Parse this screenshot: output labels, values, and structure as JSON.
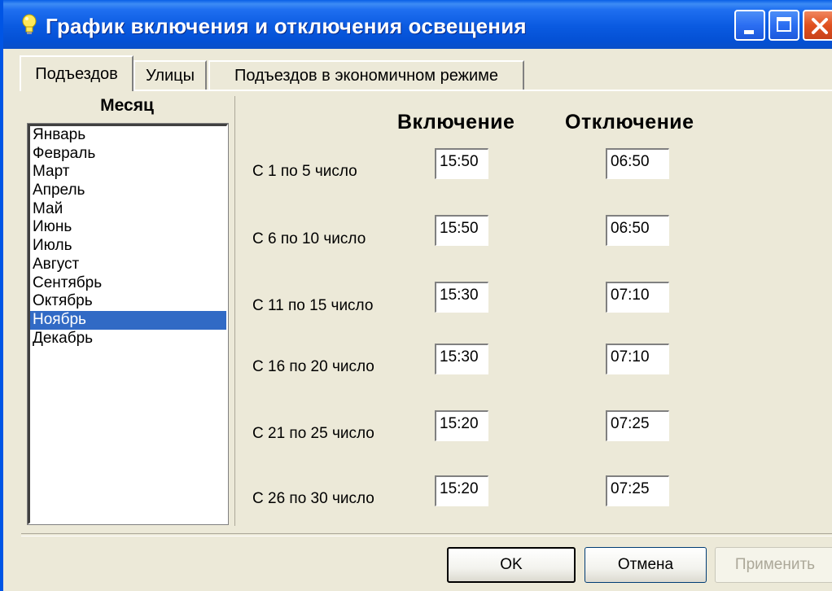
{
  "window": {
    "title": "График включения и отключения освещения",
    "icon": "lightbulb-icon"
  },
  "tabs": [
    {
      "label": "Подъездов",
      "active": true
    },
    {
      "label": "Улицы",
      "active": false
    },
    {
      "label": "Подъездов в экономичном режиме",
      "active": false
    }
  ],
  "months": {
    "header": "Месяц",
    "items": [
      "Январь",
      "Февраль",
      "Март",
      "Апрель",
      "Май",
      "Июнь",
      "Июль",
      "Август",
      "Сентябрь",
      "Октябрь",
      "Ноябрь",
      "Декабрь"
    ],
    "selected": "Ноябрь"
  },
  "schedule": {
    "on_header": "Включение",
    "off_header": "Отключение",
    "rows": [
      {
        "label": "С 1 по 5 число",
        "on": "15:50",
        "off": "06:50"
      },
      {
        "label": "С 6 по 10 число",
        "on": "15:50",
        "off": "06:50"
      },
      {
        "label": "С 11 по 15 число",
        "on": "15:30",
        "off": "07:10"
      },
      {
        "label": "С 16 по 20 число",
        "on": "15:30",
        "off": "07:10"
      },
      {
        "label": "С 21 по 25 число",
        "on": "15:20",
        "off": "07:25"
      },
      {
        "label": "С 26 по 30 число",
        "on": "15:20",
        "off": "07:25"
      }
    ]
  },
  "buttons": {
    "ok": "OK",
    "cancel": "Отмена",
    "apply": "Применить",
    "apply_enabled": false
  },
  "colors": {
    "titlebar": "#0a5ae0",
    "selection": "#316ac5",
    "face": "#ece9d8"
  }
}
